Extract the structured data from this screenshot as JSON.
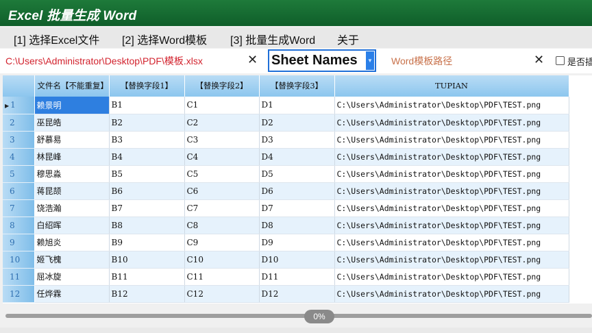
{
  "window": {
    "title": "Excel 批量生成 Word"
  },
  "menu": [
    "[1] 选择Excel文件",
    "[2] 选择Word模板",
    "[3] 批量生成Word",
    "关于"
  ],
  "toolbar": {
    "excel_path": "C:\\Users\\Administrator\\Desktop\\PDF\\模板.xlsx",
    "clear_symbol": "✕",
    "sheet_select_value": "Sheet Names",
    "word_path_placeholder": "Word模板路径",
    "checkbox_label": "是否插"
  },
  "grid": {
    "columns": [
      "文件名【不能重复】",
      "【替换字段1】",
      "【替换字段2】",
      "【替换字段3】",
      "TUPIAN"
    ],
    "selected_row": 1,
    "rows": [
      {
        "num": "1",
        "cells": [
          "赖景明",
          "B1",
          "C1",
          "D1",
          "C:\\Users\\Administrator\\Desktop\\PDF\\TEST.png"
        ]
      },
      {
        "num": "2",
        "cells": [
          "巫昆皓",
          "B2",
          "C2",
          "D2",
          "C:\\Users\\Administrator\\Desktop\\PDF\\TEST.png"
        ]
      },
      {
        "num": "3",
        "cells": [
          "舒慕易",
          "B3",
          "C3",
          "D3",
          "C:\\Users\\Administrator\\Desktop\\PDF\\TEST.png"
        ]
      },
      {
        "num": "4",
        "cells": [
          "林昆峰",
          "B4",
          "C4",
          "D4",
          "C:\\Users\\Administrator\\Desktop\\PDF\\TEST.png"
        ]
      },
      {
        "num": "5",
        "cells": [
          "穆思淼",
          "B5",
          "C5",
          "D5",
          "C:\\Users\\Administrator\\Desktop\\PDF\\TEST.png"
        ]
      },
      {
        "num": "6",
        "cells": [
          "蒋昆颉",
          "B6",
          "C6",
          "D6",
          "C:\\Users\\Administrator\\Desktop\\PDF\\TEST.png"
        ]
      },
      {
        "num": "7",
        "cells": [
          "饶浩瀚",
          "B7",
          "C7",
          "D7",
          "C:\\Users\\Administrator\\Desktop\\PDF\\TEST.png"
        ]
      },
      {
        "num": "8",
        "cells": [
          "白绍晖",
          "B8",
          "C8",
          "D8",
          "C:\\Users\\Administrator\\Desktop\\PDF\\TEST.png"
        ]
      },
      {
        "num": "9",
        "cells": [
          "赖旭炎",
          "B9",
          "C9",
          "D9",
          "C:\\Users\\Administrator\\Desktop\\PDF\\TEST.png"
        ]
      },
      {
        "num": "10",
        "cells": [
          "姬飞槐",
          "B10",
          "C10",
          "D10",
          "C:\\Users\\Administrator\\Desktop\\PDF\\TEST.png"
        ]
      },
      {
        "num": "11",
        "cells": [
          "屈冰旋",
          "B11",
          "C11",
          "D11",
          "C:\\Users\\Administrator\\Desktop\\PDF\\TEST.png"
        ]
      },
      {
        "num": "12",
        "cells": [
          "任烨霖",
          "B12",
          "C12",
          "D12",
          "C:\\Users\\Administrator\\Desktop\\PDF\\TEST.png"
        ]
      }
    ]
  },
  "progress": {
    "value": 0,
    "label": "0%"
  },
  "colors": {
    "title_bar": "#0f5e2a",
    "excel_path_text": "#d2222d",
    "selection": "#2e7fe0",
    "header": "#8cc6ee"
  }
}
